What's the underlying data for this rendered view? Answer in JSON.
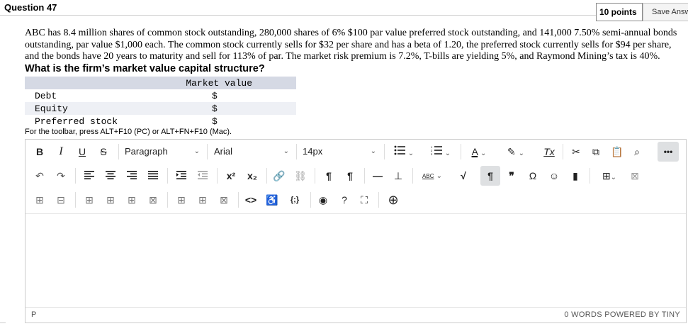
{
  "question": {
    "title": "Question 47",
    "points": "10 points",
    "save_label": "Save Answer",
    "text": "ABC has 8.4 million shares of common stock outstanding, 280,000 shares of 6% $100 par value preferred stock outstanding, and 141,000 7.50% semi-annual bonds outstanding, par value $1,000 each. The common stock currently sells for $32 per share and has a beta of 1.20, the preferred stock currently sells for $94 per share, and the bonds have 20 years to maturity and sell for 113% of par. The market risk premium is 7.2%, T-bills are yielding 5%, and Raymond Mining’s tax is 40%.",
    "prompt": "What is the firm’s market value capital structure?"
  },
  "table": {
    "header": "Market value",
    "rows": [
      {
        "label": "Debt",
        "value": "$"
      },
      {
        "label": "Equity",
        "value": "$"
      },
      {
        "label": "Preferred stock",
        "value": "$"
      }
    ]
  },
  "editor": {
    "hint": "For the toolbar, press ALT+F10 (PC) or ALT+FN+F10 (Mac).",
    "block_format": "Paragraph",
    "font_family": "Arial",
    "font_size": "14px",
    "path": "P",
    "word_count": "0 WORDS",
    "powered_by": "POWERED BY TINY",
    "toolbar": {
      "bold": "B",
      "italic": "I",
      "underline": "U",
      "strike": "S",
      "text_color": "A",
      "clear_format": "Tx",
      "more": "•••",
      "undo": "↶",
      "redo": "↷",
      "superscript": "x²",
      "subscript": "x₂",
      "ltr": "¶",
      "rtl": "¶",
      "spellcheck": "ABC",
      "paragraph_mark": "¶",
      "blockquote": "❞",
      "omega": "Ω",
      "emoji": "☺",
      "code_view": "<>",
      "accessibility": "♿",
      "code_sample": "{;}",
      "preview": "◉",
      "help": "?",
      "fullscreen": "⛶",
      "add": "⊕"
    }
  }
}
